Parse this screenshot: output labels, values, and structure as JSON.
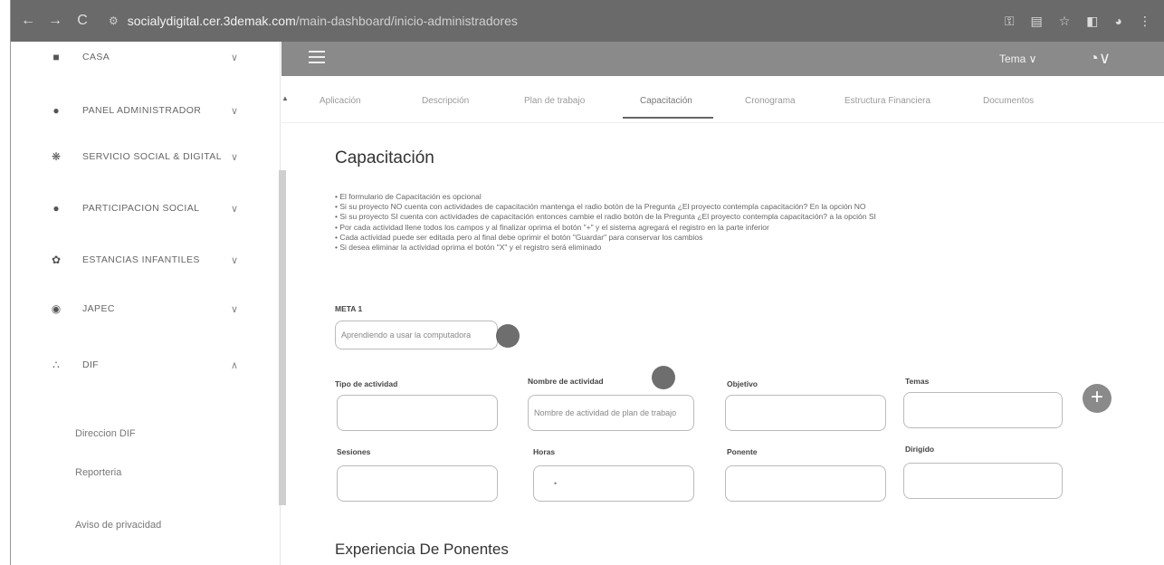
{
  "browser": {
    "back": "←",
    "forward": "→",
    "reload": "C",
    "site_icon": "⚙",
    "url_domain": "socialydigital.cer.3demak.com",
    "url_path": "/main-dashboard/inicio-administradores",
    "icons": [
      "key-icon",
      "translate-icon",
      "star-icon",
      "sidebar-icon",
      "profile-icon",
      "menu-icon"
    ]
  },
  "sidebar": {
    "items": [
      {
        "icon": "■",
        "label": "CASA",
        "chev": "∨"
      },
      {
        "icon": "●",
        "label": "PANEL ADMINISTRADOR",
        "chev": "∨"
      },
      {
        "icon": "❋",
        "label": "SERVICIO SOCIAL & DIGITAL",
        "chev": "∨"
      },
      {
        "icon": "●",
        "label": "PARTICIPACION SOCIAL",
        "chev": "∨"
      },
      {
        "icon": "✿",
        "label": "ESTANCIAS INFANTILES",
        "chev": "∨"
      },
      {
        "icon": "◉",
        "label": "JAPEC",
        "chev": "∨"
      },
      {
        "icon": "∴",
        "label": "DIF",
        "chev": "∧"
      }
    ],
    "subitems": [
      "Direccion DIF",
      "Reporteria",
      "Aviso de privacidad"
    ]
  },
  "appbar": {
    "tema_label": "Tema ∨",
    "user_icon": "◔∨"
  },
  "tabs": [
    "Aplicación",
    "Descripción",
    "Plan de trabajo",
    "Capacitación",
    "Cronograma",
    "Estructura Financiera",
    "Documentos"
  ],
  "active_tab": "Capacitación",
  "main": {
    "title": "Capacitación",
    "instructions": [
      "El formulario de Capacitación es opcional",
      "Si su proyecto NO cuenta con actividades de capacitación mantenga el radio botón de la Pregunta ¿El proyecto contempla capacitación? En la opción NO",
      "Si su proyecto SI cuenta con actividades de capacitación entonces cambie el radio botón de la Pregunta ¿El proyecto contempla capacitación? a la opción SI",
      "Por cada actividad llene todos los campos y al finalizar oprima el botón \"+\" y el sistema agregará el registro en la parte inferior",
      "Cada actividad puede ser editada pero al final debe oprimir el botón \"Guardar\" para conservar los cambios",
      "Si desea eliminar la actividad oprima el botón \"X\" y el registro será eliminado"
    ],
    "meta_label": "META 1",
    "meta_value": "Aprendiendo a usar la computadora",
    "labels": {
      "tipo": "Tipo de actividad",
      "nombre": "Nombre de actividad",
      "objetivo": "Objetivo",
      "temas": "Temas",
      "sesiones": "Sesiones",
      "horas": "Horas",
      "ponente": "Ponente",
      "dirigido": "Dirigido"
    },
    "nombre_placeholder": "Nombre de actividad de plan de trabajo",
    "horas_value": "•",
    "add_label": "+",
    "section2_title": "Experiencia De Ponentes"
  },
  "colors": {
    "browser_bar": "#6a6a6a",
    "app_bar": "#8a8a8a",
    "add_button": "#8a8a8a"
  }
}
